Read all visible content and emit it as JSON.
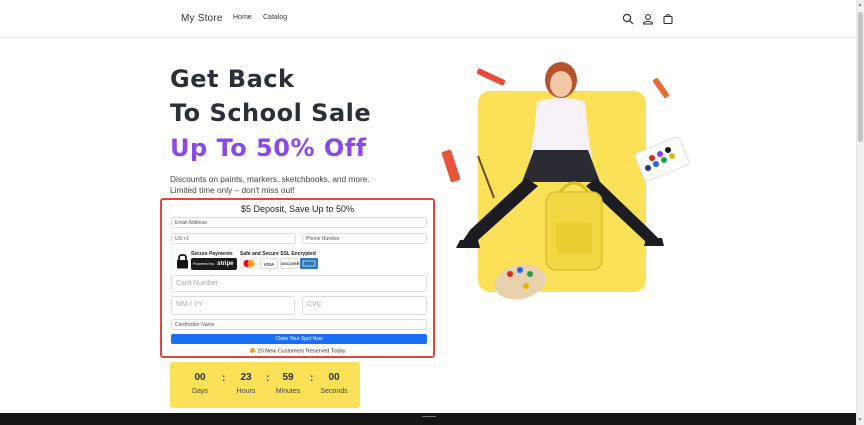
{
  "header": {
    "logo": "My Store",
    "nav": [
      "Home",
      "Catalog"
    ],
    "icons": [
      "search-icon",
      "account-icon",
      "cart-icon"
    ]
  },
  "hero": {
    "line1": "Get Back",
    "line2": "To School Sale",
    "line3": "Up To 50% Off",
    "description_1": "Discounts on paints, markers, sketchbooks, and more.",
    "description_2": "Limited time only – don't miss out!",
    "accent_color": "#8b4ae8"
  },
  "form": {
    "title": "$5 Deposit, Save Up to 50%",
    "email_placeholder": "Email Address",
    "country_value": "US +1",
    "phone_placeholder": "Phone Number",
    "secure_label": "Secure Payments",
    "stripe_powered": "Powered by",
    "stripe_brand": "stripe",
    "ssl_label": "Safe and Secure SSL Encrypted",
    "card_brands": [
      "VISA",
      "DISCOVER"
    ],
    "card_placeholder": "Card Number",
    "mmyy_placeholder": "MM / YY",
    "cvc_placeholder": "CVC",
    "name_placeholder": "Cardholder Name",
    "button_label": "Claim Your Spot Now",
    "reserved_text": "20 New Customers Reserved Today",
    "border_color": "#e0463b",
    "button_color": "#1a6ff5"
  },
  "countdown": {
    "days": "00",
    "hours": "23",
    "minutes": "59",
    "seconds": "00",
    "days_label": "Days",
    "hours_label": "Hours",
    "minutes_label": "Minutes",
    "seconds_label": "Seconds",
    "separator": ":",
    "bg_color": "#fbe158"
  }
}
